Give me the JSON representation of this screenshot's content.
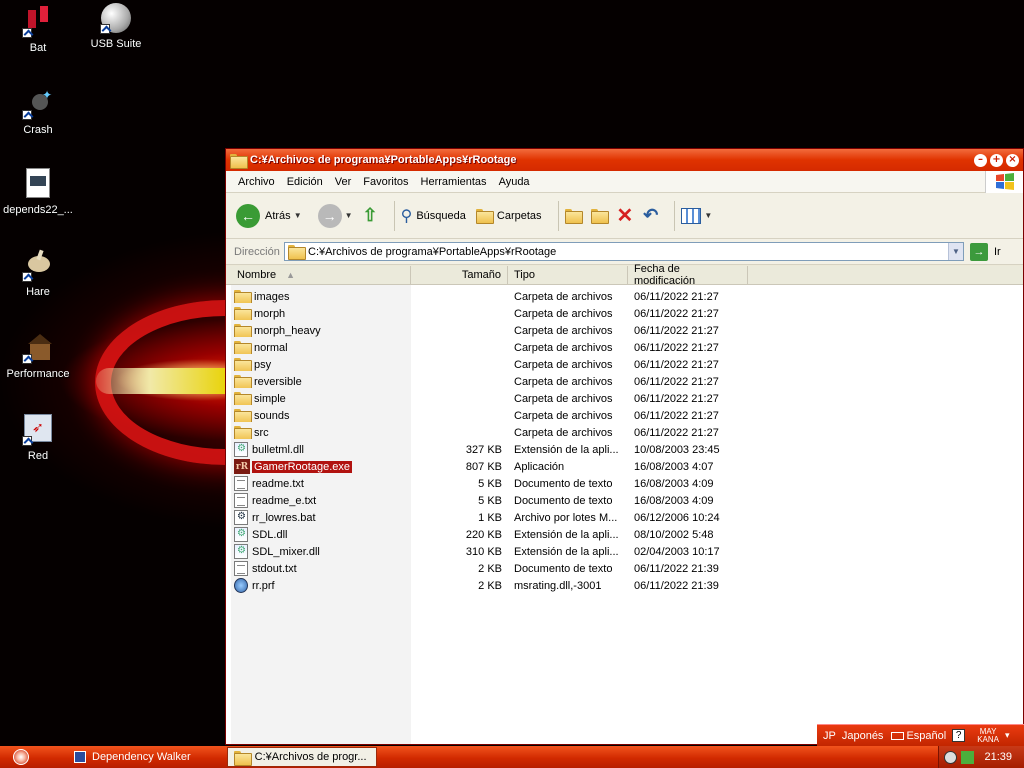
{
  "desktop": {
    "icons": [
      {
        "label": "Bat",
        "icon": "bat-icon"
      },
      {
        "label": "USB Suite",
        "icon": "usb-suite-icon"
      },
      {
        "label": "Crash",
        "icon": "crash-icon"
      },
      {
        "label": "depends22_...",
        "icon": "depends-icon"
      },
      {
        "label": "Hare",
        "icon": "hare-icon"
      },
      {
        "label": "Performance",
        "icon": "performance-icon"
      },
      {
        "label": "Red",
        "icon": "red-icon"
      }
    ]
  },
  "window": {
    "title": "C:¥Archivos de programa¥PortableApps¥rRootage",
    "menu": [
      "Archivo",
      "Edición",
      "Ver",
      "Favoritos",
      "Herramientas",
      "Ayuda"
    ],
    "toolbar": {
      "back_label": "Atrás",
      "search_label": "Búsqueda",
      "folders_label": "Carpetas"
    },
    "address": {
      "label": "Dirección",
      "value": "C:¥Archivos de programa¥PortableApps¥rRootage",
      "go_label": "Ir"
    },
    "columns": {
      "name": "Nombre",
      "size": "Tamaño",
      "type": "Tipo",
      "modified": "Fecha de modificación"
    },
    "files": [
      {
        "name": "images",
        "size": "",
        "type": "Carpeta de archivos",
        "modified": "06/11/2022 21:27",
        "kind": "folder"
      },
      {
        "name": "morph",
        "size": "",
        "type": "Carpeta de archivos",
        "modified": "06/11/2022 21:27",
        "kind": "folder"
      },
      {
        "name": "morph_heavy",
        "size": "",
        "type": "Carpeta de archivos",
        "modified": "06/11/2022 21:27",
        "kind": "folder"
      },
      {
        "name": "normal",
        "size": "",
        "type": "Carpeta de archivos",
        "modified": "06/11/2022 21:27",
        "kind": "folder"
      },
      {
        "name": "psy",
        "size": "",
        "type": "Carpeta de archivos",
        "modified": "06/11/2022 21:27",
        "kind": "folder"
      },
      {
        "name": "reversible",
        "size": "",
        "type": "Carpeta de archivos",
        "modified": "06/11/2022 21:27",
        "kind": "folder"
      },
      {
        "name": "simple",
        "size": "",
        "type": "Carpeta de archivos",
        "modified": "06/11/2022 21:27",
        "kind": "folder"
      },
      {
        "name": "sounds",
        "size": "",
        "type": "Carpeta de archivos",
        "modified": "06/11/2022 21:27",
        "kind": "folder"
      },
      {
        "name": "src",
        "size": "",
        "type": "Carpeta de archivos",
        "modified": "06/11/2022 21:27",
        "kind": "folder"
      },
      {
        "name": "bulletml.dll",
        "size": "327 KB",
        "type": "Extensión de la apli...",
        "modified": "10/08/2003 23:45",
        "kind": "dll"
      },
      {
        "name": "GamerRootage.exe",
        "size": "807 KB",
        "type": "Aplicación",
        "modified": "16/08/2003 4:07",
        "kind": "exe",
        "selected": true
      },
      {
        "name": "readme.txt",
        "size": "5 KB",
        "type": "Documento de texto",
        "modified": "16/08/2003 4:09",
        "kind": "txt"
      },
      {
        "name": "readme_e.txt",
        "size": "5 KB",
        "type": "Documento de texto",
        "modified": "16/08/2003 4:09",
        "kind": "txt"
      },
      {
        "name": "rr_lowres.bat",
        "size": "1 KB",
        "type": "Archivo por lotes M...",
        "modified": "06/12/2006 10:24",
        "kind": "bat"
      },
      {
        "name": "SDL.dll",
        "size": "220 KB",
        "type": "Extensión de la apli...",
        "modified": "08/10/2002 5:48",
        "kind": "dll"
      },
      {
        "name": "SDL_mixer.dll",
        "size": "310 KB",
        "type": "Extensión de la apli...",
        "modified": "02/04/2003 10:17",
        "kind": "dll"
      },
      {
        "name": "stdout.txt",
        "size": "2 KB",
        "type": "Documento de texto",
        "modified": "06/11/2022 21:39",
        "kind": "txt"
      },
      {
        "name": "rr.prf",
        "size": "2 KB",
        "type": "msrating.dll,-3001",
        "modified": "06/11/2022 21:39",
        "kind": "prf"
      }
    ]
  },
  "langbar": {
    "lang_code": "JP",
    "lang_name": "Japonés",
    "keyboard": "Español",
    "help": "?",
    "ime_top": "MAY",
    "ime_bottom": "KANA"
  },
  "taskbar": {
    "tasks": [
      {
        "label": "Dependency Walker",
        "active": false
      },
      {
        "label": "C:¥Archivos de progr...",
        "active": true
      }
    ],
    "clock": "21:39"
  },
  "colors": {
    "title_bar": "#e03300",
    "taskbar": "#d12a00",
    "selection": "#b1120f"
  }
}
